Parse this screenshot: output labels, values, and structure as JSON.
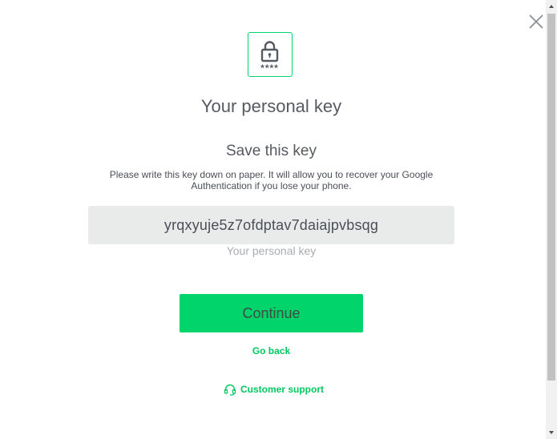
{
  "dialog": {
    "close_icon": "close-icon",
    "lock_icon": "lock-icon",
    "lock_caption": "****",
    "title": "Your personal key",
    "subtitle": "Save this key",
    "description": "Please write this key down on paper. It will allow you to recover your Google Authentication if you lose your phone.",
    "personal_key": "yrqxyuje5z7ofdptav7daiajpvbsqg",
    "key_caption": "Your personal key",
    "continue_label": "Continue",
    "go_back_label": "Go back",
    "support_icon": "headset-icon",
    "support_label": "Customer support"
  },
  "colors": {
    "accent": "#00d46a",
    "link": "#00c95f",
    "text": "#555b60",
    "key_background": "#e9ebeb",
    "muted": "#a9adb1"
  }
}
